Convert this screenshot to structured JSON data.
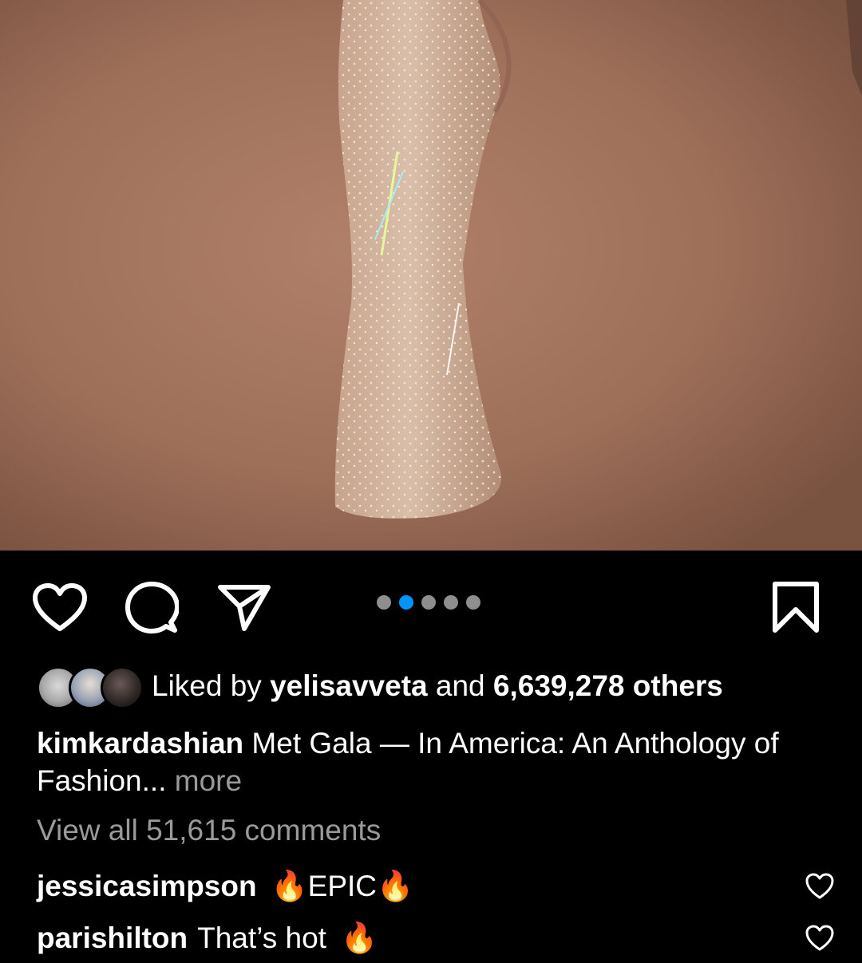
{
  "post": {
    "image_icon": "post-photo-dress",
    "carousel": {
      "count": 5,
      "active_index": 1
    },
    "actions": {
      "like_icon": "heart-icon",
      "comment_icon": "comment-bubble-icon",
      "share_icon": "paper-plane-icon",
      "save_icon": "bookmark-icon"
    },
    "likes": {
      "prefix": "Liked by",
      "user": "yelisavveta",
      "middle": "and",
      "count_text": "6,639,278 others"
    },
    "caption": {
      "username": "kimkardashian",
      "text": "Met Gala — In America: An Anthology of Fashion...",
      "more": "more"
    },
    "view_all_comments": "View all 51,615 comments",
    "comments": [
      {
        "username": "jessicasimpson",
        "emoji_before": "🔥",
        "text": "EPIC",
        "emoji_after": "🔥"
      },
      {
        "username": "parishilton",
        "text": "That’s hot",
        "emoji_after": "🔥"
      }
    ]
  },
  "colors": {
    "background": "#000000",
    "text": "#ffffff",
    "muted": "#9a9a9a",
    "active_dot": "#0095f6",
    "inactive_dot": "#8e8e8e"
  }
}
